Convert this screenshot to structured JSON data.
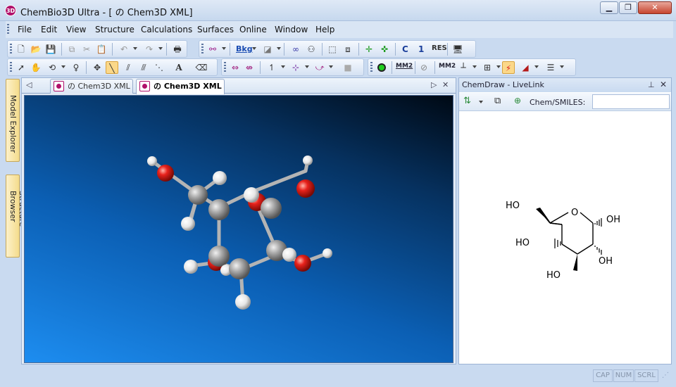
{
  "window": {
    "title": "ChemBio3D Ultra - [ の Chem3D XML]",
    "app_icon_text": "3D",
    "minimize": "▁",
    "restore": "❐",
    "close": "✕"
  },
  "menu": {
    "items": [
      "File",
      "Edit",
      "View",
      "Structure",
      "Calculations",
      "Surfaces",
      "Online",
      "Window",
      "Help"
    ]
  },
  "toolbar": {
    "bkg_label": "Bkg",
    "mm2_label": "MM2",
    "c_label": "C",
    "one_label": "1",
    "res_label": "RES",
    "text_tool": "A"
  },
  "side_tabs": {
    "model_explorer": "Model Explorer",
    "structure_browser": "Structure Browser"
  },
  "document": {
    "tabs": [
      {
        "label": "の Chem3D XML",
        "active": false
      },
      {
        "label": "の Chem3D XML",
        "active": true
      }
    ]
  },
  "livelink": {
    "title": "ChemDraw - LiveLink",
    "smiles_label": "Chem/SMILES:",
    "smiles_value": "",
    "labels": {
      "ho_top": "HO",
      "o_ring": "O",
      "oh_right": "OH",
      "ho_left": "HO",
      "oh_bottom_right": "OH",
      "ho_bottom": "HO"
    }
  },
  "status": {
    "cap": "CAP",
    "num": "NUM",
    "scrl": "SCRL"
  },
  "colors": {
    "carbon": "#9a9a9a",
    "oxygen": "#e8221c",
    "hydrogen": "#f2f2f2",
    "accent": "#b0106a",
    "bond": "#000000"
  }
}
